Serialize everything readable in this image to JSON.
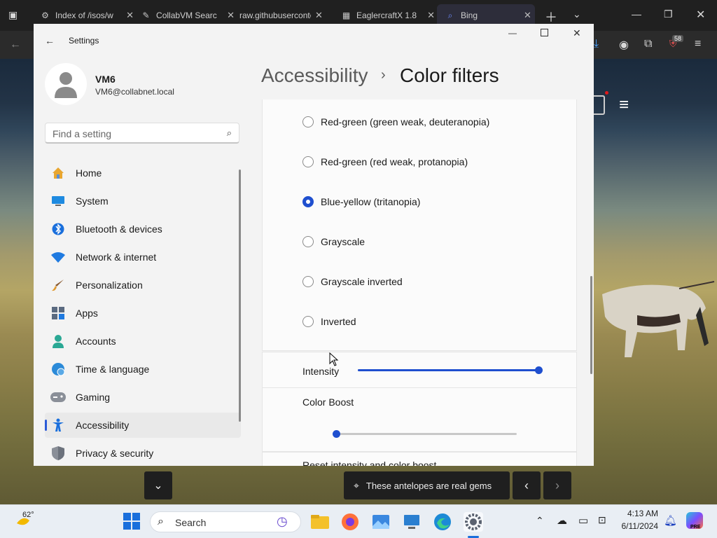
{
  "browser": {
    "tabs": [
      {
        "label": "Index of /isos/w",
        "icon": "archive-icon"
      },
      {
        "label": "CollabVM Searc",
        "icon": "feather-icon"
      },
      {
        "label": "raw.githubuserconte",
        "icon": "none"
      },
      {
        "label": "EaglercraftX 1.8",
        "icon": "game-icon"
      },
      {
        "label": "Bing",
        "icon": "search-icon"
      }
    ],
    "extensions_badge": "58"
  },
  "settings": {
    "window_title": "Settings",
    "user": {
      "name": "VM6",
      "email": "VM6@collabnet.local"
    },
    "search_placeholder": "Find a setting",
    "nav": [
      {
        "label": "Home",
        "icon": "home-icon"
      },
      {
        "label": "System",
        "icon": "monitor-icon"
      },
      {
        "label": "Bluetooth & devices",
        "icon": "bluetooth-icon"
      },
      {
        "label": "Network & internet",
        "icon": "wifi-icon"
      },
      {
        "label": "Personalization",
        "icon": "brush-icon"
      },
      {
        "label": "Apps",
        "icon": "apps-icon"
      },
      {
        "label": "Accounts",
        "icon": "person-icon"
      },
      {
        "label": "Time & language",
        "icon": "globe-clock-icon"
      },
      {
        "label": "Gaming",
        "icon": "gamepad-icon"
      },
      {
        "label": "Accessibility",
        "icon": "accessibility-icon"
      },
      {
        "label": "Privacy & security",
        "icon": "shield-icon"
      }
    ],
    "active_nav": "Accessibility",
    "breadcrumb": {
      "parent": "Accessibility",
      "separator": "›",
      "current": "Color filters"
    },
    "filters": [
      {
        "label": "Red-green (green weak, deuteranopia)",
        "selected": false
      },
      {
        "label": "Red-green (red weak, protanopia)",
        "selected": false
      },
      {
        "label": "Blue-yellow (tritanopia)",
        "selected": true
      },
      {
        "label": "Grayscale",
        "selected": false
      },
      {
        "label": "Grayscale inverted",
        "selected": false
      },
      {
        "label": "Inverted",
        "selected": false
      }
    ],
    "intensity": {
      "label": "Intensity",
      "value": 1.0
    },
    "color_boost": {
      "label": "Color Boost",
      "value": 0.0
    },
    "reset_label": "Reset intensity and color boost"
  },
  "overlay": {
    "caption": "These antelopes are real gems"
  },
  "taskbar": {
    "weather": "62°",
    "search_label": "Search",
    "time": "4:13 AM",
    "date": "6/11/2024",
    "copilot_badge": "PRE"
  },
  "colors": {
    "accent": "#1f4fcf",
    "taskbar": "#e9eef4"
  }
}
